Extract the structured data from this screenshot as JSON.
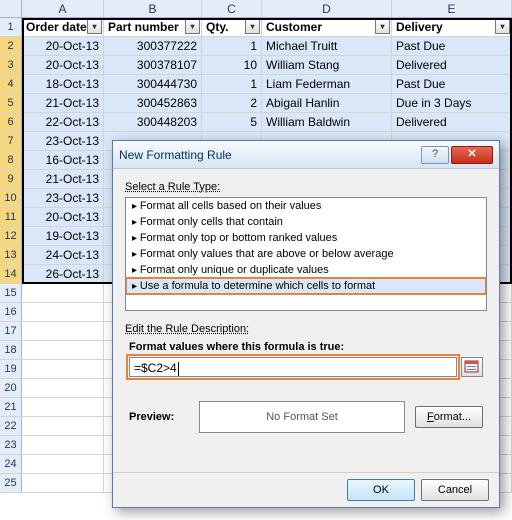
{
  "columns": {
    "A": "A",
    "B": "B",
    "C": "C",
    "D": "D",
    "E": "E"
  },
  "headers": {
    "A": "Order date",
    "B": "Part number",
    "C": "Qty.",
    "D": "Customer",
    "E": "Delivery"
  },
  "rows": [
    {
      "n": "1",
      "header": true
    },
    {
      "n": "2",
      "A": "20-Oct-13",
      "B": "300377222",
      "C": "1",
      "D": "Michael Truitt",
      "E": "Past Due"
    },
    {
      "n": "3",
      "A": "20-Oct-13",
      "B": "300378107",
      "C": "10",
      "D": "William Stang",
      "E": "Delivered"
    },
    {
      "n": "4",
      "A": "18-Oct-13",
      "B": "300444730",
      "C": "1",
      "D": "Liam Federman",
      "E": "Past Due"
    },
    {
      "n": "5",
      "A": "21-Oct-13",
      "B": "300452863",
      "C": "2",
      "D": "Abigail Hanlin",
      "E": "Due in 3 Days"
    },
    {
      "n": "6",
      "A": "22-Oct-13",
      "B": "300448203",
      "C": "5",
      "D": "William Baldwin",
      "E": "Delivered"
    },
    {
      "n": "7",
      "A": "23-Oct-13"
    },
    {
      "n": "8",
      "A": "16-Oct-13"
    },
    {
      "n": "9",
      "A": "21-Oct-13"
    },
    {
      "n": "10",
      "A": "23-Oct-13"
    },
    {
      "n": "11",
      "A": "20-Oct-13"
    },
    {
      "n": "12",
      "A": "19-Oct-13"
    },
    {
      "n": "13",
      "A": "24-Oct-13"
    },
    {
      "n": "14",
      "A": "26-Oct-13"
    },
    {
      "n": "15"
    },
    {
      "n": "16"
    },
    {
      "n": "17"
    },
    {
      "n": "18"
    },
    {
      "n": "19"
    },
    {
      "n": "20"
    },
    {
      "n": "21"
    },
    {
      "n": "22"
    },
    {
      "n": "23"
    },
    {
      "n": "24"
    },
    {
      "n": "25"
    }
  ],
  "dialog": {
    "title": "New Formatting Rule",
    "help_icon": "?",
    "close_icon": "✕",
    "select_rule_label": "Select a Rule Type:",
    "rule_types": [
      "Format all cells based on their values",
      "Format only cells that contain",
      "Format only top or bottom ranked values",
      "Format only values that are above or below average",
      "Format only unique or duplicate values",
      "Use a formula to determine which cells to format"
    ],
    "selected_rule_index": 5,
    "edit_desc_label": "Edit the Rule Description:",
    "formula_label": "Format values where this formula is true:",
    "formula_value": "=$C2>4",
    "preview_label": "Preview:",
    "preview_text": "No Format Set",
    "format_btn": "Format...",
    "ok": "OK",
    "cancel": "Cancel"
  }
}
